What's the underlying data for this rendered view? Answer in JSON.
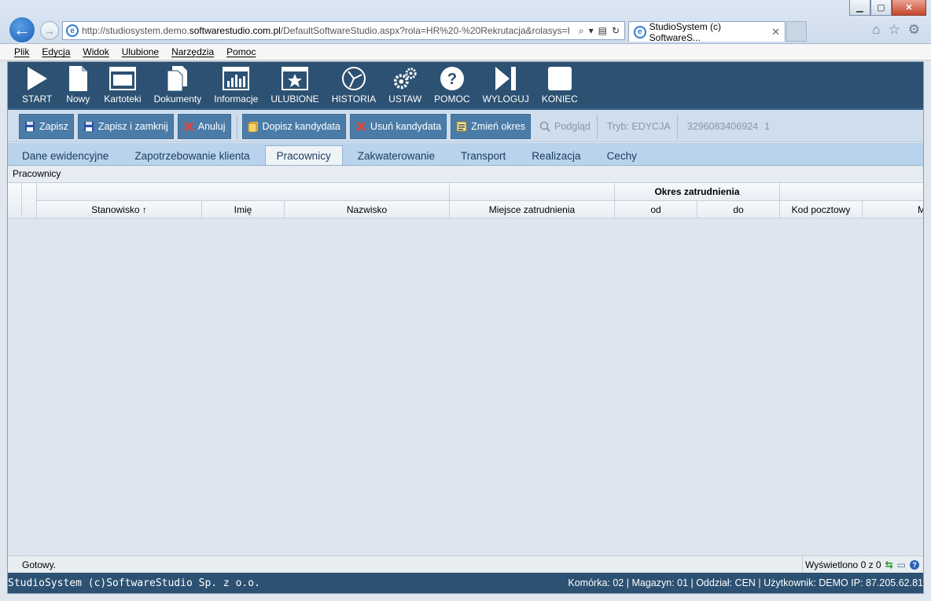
{
  "browser": {
    "url_prefix": "http://studiosystem.demo.",
    "url_domain": "softwarestudio.com.pl",
    "url_rest": "/DefaultSoftwareStudio.aspx?rola=HR%20-%20Rekrutacja&rolasys=H",
    "tab_title": "StudioSystem (c) SoftwareS...",
    "menu": [
      "Plik",
      "Edycja",
      "Widok",
      "Ulubione",
      "Narzędzia",
      "Pomoc"
    ]
  },
  "main_toolbar": [
    {
      "label": "START",
      "icon": "play-icon"
    },
    {
      "label": "Nowy",
      "icon": "new-document-icon"
    },
    {
      "label": "Kartoteki",
      "icon": "window-icon"
    },
    {
      "label": "Dokumenty",
      "icon": "documents-icon"
    },
    {
      "label": "Informacje",
      "icon": "chart-icon"
    },
    {
      "label": "ULUBIONE",
      "icon": "star-icon"
    },
    {
      "label": "HISTORIA",
      "icon": "history-icon"
    },
    {
      "label": "USTAW",
      "icon": "gears-icon"
    },
    {
      "label": "POMOC",
      "icon": "help-icon"
    },
    {
      "label": "WYLOGUJ",
      "icon": "logout-icon"
    },
    {
      "label": "KONIEC",
      "icon": "end-icon"
    }
  ],
  "sub_toolbar": {
    "save": "Zapisz",
    "save_close": "Zapisz i zamknij",
    "cancel": "Anuluj",
    "add_candidate": "Dopisz kandydata",
    "remove_candidate": "Usuń kandydata",
    "change_period": "Zmień okres",
    "preview": "Podgląd",
    "mode": "Tryb: EDYCJA",
    "record_id": "3296083406924",
    "record_num": "1"
  },
  "tabs": [
    "Dane ewidencyjne",
    "Zapotrzebowanie klienta",
    "Pracownicy",
    "Zakwaterowanie",
    "Transport",
    "Realizacja",
    "Cechy"
  ],
  "active_tab": "Pracownicy",
  "panel": {
    "title": "Pracownicy",
    "group_header": "Okres zatrudnienia",
    "columns": [
      "Stanowisko ↑",
      "Imię",
      "Nazwisko",
      "Miejsce zatrudnienia",
      "od",
      "do",
      "Kod pocztowy",
      "M"
    ]
  },
  "status": {
    "left": "Gotowy.",
    "count": "Wyświetlono 0 z 0"
  },
  "footer": {
    "left": "StudioSystem (c)SoftwareStudio Sp. z o.o.",
    "right": "Komórka: 02 | Magazyn: 01 | Oddział: CEN | Użytkownik: DEMO IP: 87.205.62.81"
  }
}
